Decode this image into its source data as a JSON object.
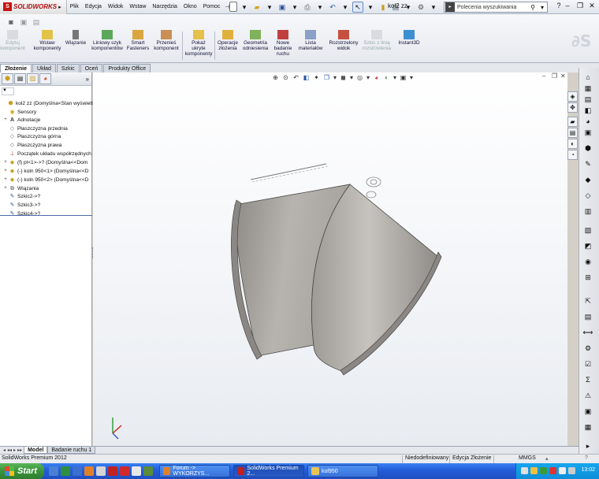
{
  "app": {
    "brand": "SOLIDWORKS",
    "document_title": "kol2 zz"
  },
  "menu": [
    "Plik",
    "Edycja",
    "Widok",
    "Wstaw",
    "Narzędzia",
    "Okno",
    "Pomoc"
  ],
  "search": {
    "placeholder": "Polecenia wyszukiwania"
  },
  "command_manager": [
    {
      "label": "Edytuj\nkomponent",
      "icon": "edit-component-icon",
      "disabled": true
    },
    {
      "label": "Wstaw\nkomponenty",
      "icon": "insert-components-icon",
      "disabled": false
    },
    {
      "label": "Wiązanie",
      "icon": "mate-icon",
      "disabled": false
    },
    {
      "label": "Liniowy szyk\nkomponentów",
      "icon": "linear-pattern-icon",
      "disabled": false
    },
    {
      "label": "Smart\nFasteners",
      "icon": "smart-fasteners-icon",
      "disabled": false
    },
    {
      "label": "Przenieś\nkomponent",
      "icon": "move-component-icon",
      "disabled": false
    },
    {
      "label": "Pokaż\nukryte\nkomponenty",
      "icon": "show-hidden-icon",
      "disabled": false
    },
    {
      "label": "Operacje\nzłożenia",
      "icon": "assembly-features-icon",
      "disabled": false
    },
    {
      "label": "Geometria\nodniesienia",
      "icon": "reference-geometry-icon",
      "disabled": false
    },
    {
      "label": "Nowe\nbadanie\nruchu",
      "icon": "motion-study-icon",
      "disabled": false
    },
    {
      "label": "Lista\nmateriałów",
      "icon": "bom-icon",
      "disabled": false
    },
    {
      "label": "Rozstrzelony\nwidok",
      "icon": "exploded-view-icon",
      "disabled": false
    },
    {
      "label": "Szkic z linią\nrozstrzelenia",
      "icon": "explode-line-sketch-icon",
      "disabled": true
    },
    {
      "label": "Instant3D",
      "icon": "instant3d-icon",
      "disabled": false
    }
  ],
  "tabs": [
    "Złożenie",
    "Układ",
    "Szkic",
    "Oceń",
    "Produkty Office"
  ],
  "tree": [
    {
      "label": "kol2 zz  (Domyślna<Stan wyświetlan",
      "icon": "assembly-icon",
      "expander": ""
    },
    {
      "label": "Sensory",
      "icon": "sensor-icon",
      "expander": ""
    },
    {
      "label": "Adnotacje",
      "icon": "annotation-icon",
      "expander": "+"
    },
    {
      "label": "Płaszczyzna przednia",
      "icon": "plane-icon",
      "expander": ""
    },
    {
      "label": "Płaszczyzna górna",
      "icon": "plane-icon",
      "expander": ""
    },
    {
      "label": "Płaszczyzna prawa",
      "icon": "plane-icon",
      "expander": ""
    },
    {
      "label": "Początek układu współrzędnych",
      "icon": "origin-icon",
      "expander": ""
    },
    {
      "label": "(f) pl<1>->? (Domyślna<<Dom",
      "icon": "part-icon",
      "expander": "+"
    },
    {
      "label": "(-) koln 950<1> (Domyślna<<D",
      "icon": "part-icon",
      "expander": "+"
    },
    {
      "label": "(-) koln 950<2> (Domyślna<<D",
      "icon": "part-icon",
      "expander": "+"
    },
    {
      "label": "Wiązania",
      "icon": "mates-folder-icon",
      "expander": "+"
    },
    {
      "label": "Szkic2->?",
      "icon": "sketch-icon",
      "expander": ""
    },
    {
      "label": "Szkic3->?",
      "icon": "sketch-icon",
      "expander": ""
    },
    {
      "label": "Szkic4->?",
      "icon": "sketch-icon",
      "expander": ""
    }
  ],
  "model_tabs": [
    "Model",
    "Badanie ruchu 1"
  ],
  "status": {
    "product": "SolidWorks Premium 2012",
    "definition": "Niedodefiniowany",
    "mode": "Edycja Złożenie",
    "units": "MMGS"
  },
  "taskbar": {
    "start_label": "Start",
    "windows": [
      "Forum -> WYKORZYS...",
      "SolidWorks Premium 2...",
      "kol950"
    ],
    "clock": "13:02"
  }
}
